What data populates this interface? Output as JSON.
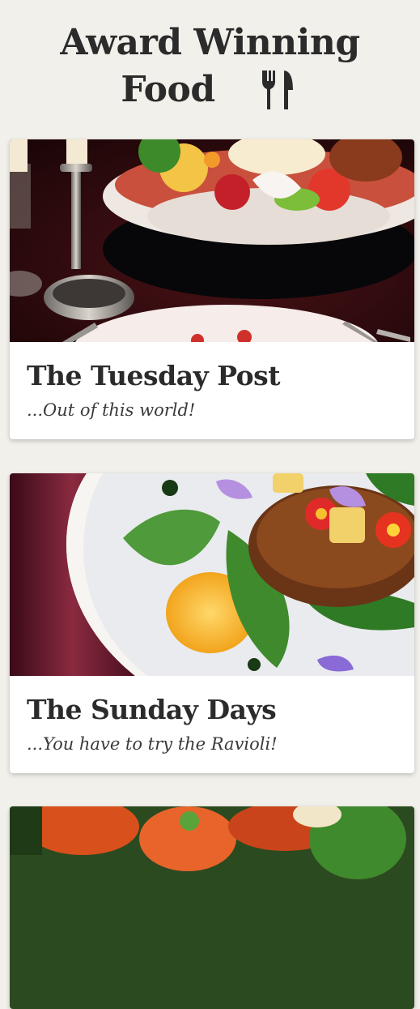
{
  "header": {
    "title_line1": "Award Winning",
    "title_line2": "Food"
  },
  "icons": {
    "header_icon": "fork-knife-icon"
  },
  "cards": [
    {
      "title": "The Tuesday Post",
      "subtitle": "...Out of this world!",
      "image": "plated-dish-with-candles"
    },
    {
      "title": "The Sunday Days",
      "subtitle": "...You have to try the Ravioli!",
      "image": "crispy-patty-with-greens-and-flowers"
    },
    {
      "image": "roasted-vegetables"
    }
  ],
  "colors": {
    "page_background": "#f2f0eb",
    "text": "#2b2b2b",
    "card_background": "#ffffff"
  }
}
